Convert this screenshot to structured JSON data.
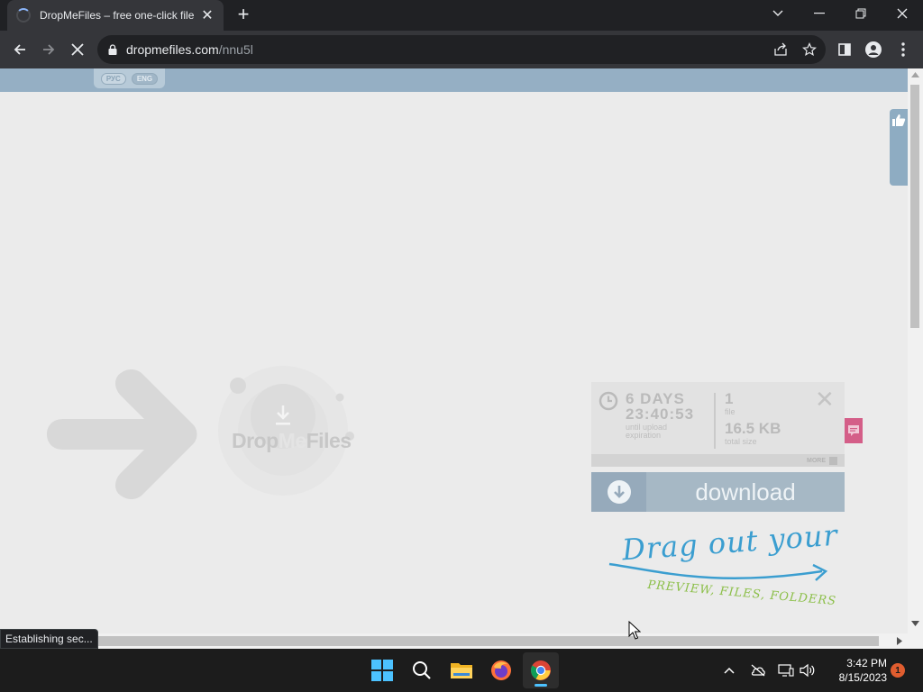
{
  "browser": {
    "tab_title": "DropMeFiles – free one-click file",
    "url_host": "dropmefiles.com",
    "url_path": "/nnu5l",
    "status_text": "Establishing sec..."
  },
  "site": {
    "languages": [
      "РУС",
      "ENG"
    ],
    "active_language": "ENG",
    "logo": {
      "drop": "Drop",
      "me": "Me",
      "files": "Files"
    },
    "card": {
      "days": "6 DAYS",
      "time": "23:40:53",
      "expiration_caption": "until upload expiration",
      "file_count": "1",
      "file_count_label": "file",
      "total_size": "16.5 KB",
      "total_size_label": "total size",
      "more_label": "MORE"
    },
    "download_label": "download",
    "drag_title": "Drag out your",
    "drag_subtitle": "PREVIEW, FILES, FOLDERS"
  },
  "taskbar": {
    "time": "3:42 PM",
    "date": "8/15/2023",
    "notification_count": "1"
  },
  "colors": {
    "header_blue": "#95afc4",
    "download_blue": "#a6b8c5",
    "drag_blue": "#3b9ed0",
    "drag_green": "#8cbf49",
    "side_pink": "#d45e88"
  }
}
